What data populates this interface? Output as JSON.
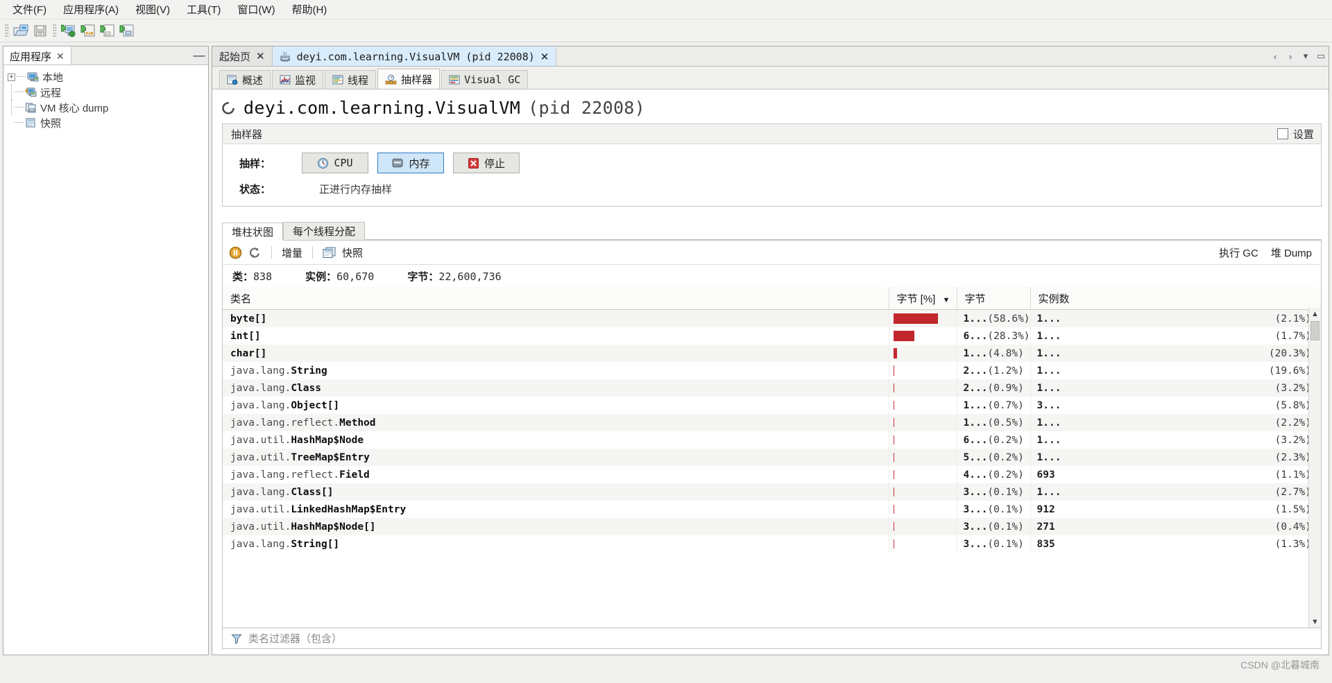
{
  "menubar": [
    {
      "label": "文件(F)",
      "mnemonic": "F"
    },
    {
      "label": "应用程序(A)",
      "mnemonic": "A"
    },
    {
      "label": "视图(V)",
      "mnemonic": "V"
    },
    {
      "label": "工具(T)",
      "mnemonic": "T"
    },
    {
      "label": "窗口(W)",
      "mnemonic": "W"
    },
    {
      "label": "帮助(H)",
      "mnemonic": "H"
    }
  ],
  "toolbar": {
    "buttons": [
      {
        "name": "open-file-icon"
      },
      {
        "name": "save-icon"
      },
      {
        "name": "add-remote-host-icon"
      },
      {
        "name": "add-jmx-connection-icon"
      },
      {
        "name": "load-snapshot-icon"
      },
      {
        "name": "add-vm-coredump-icon"
      }
    ]
  },
  "sidebar": {
    "tab_label": "应用程序",
    "close_label": "✕",
    "minimize_label": "—",
    "items": [
      {
        "label": "本地",
        "icon": "local-computer-icon",
        "expander": "+"
      },
      {
        "label": "远程",
        "icon": "remote-computer-icon",
        "expander": ""
      },
      {
        "label": "VM 核心 dump",
        "icon": "vm-coredump-icon",
        "expander": ""
      },
      {
        "label": "快照",
        "icon": "snapshot-icon",
        "expander": ""
      }
    ]
  },
  "document_tabs": [
    {
      "label": "起始页",
      "icon": "",
      "active": false,
      "closable": true
    },
    {
      "label": "deyi.com.learning.VisualVM (pid 22008)",
      "icon": "java-cup-icon",
      "active": true,
      "closable": true
    }
  ],
  "document_tab_controls": [
    "‹",
    "›",
    "▾",
    "▭"
  ],
  "sub_tabs": [
    {
      "label": "概述",
      "icon": "overview-icon",
      "active": false
    },
    {
      "label": "监视",
      "icon": "monitor-icon",
      "active": false
    },
    {
      "label": "线程",
      "icon": "threads-icon",
      "active": false
    },
    {
      "label": "抽样器",
      "icon": "sampler-icon",
      "active": true
    },
    {
      "label": "Visual GC",
      "icon": "visualgc-icon",
      "active": false
    }
  ],
  "app": {
    "title": "deyi.com.learning.VisualVM",
    "pid_text": "(pid 22008)",
    "icon": "loading-spinner-icon"
  },
  "sampler_panel": {
    "header": "抽样器",
    "settings_label": "设置",
    "settings_checked": false,
    "sample_label": "抽样：",
    "buttons": [
      {
        "label": "CPU",
        "icon": "clock-icon",
        "state": "normal"
      },
      {
        "label": "内存",
        "icon": "memory-chip-icon",
        "state": "selected"
      },
      {
        "label": "停止",
        "icon": "stop-red-x-icon",
        "state": "normal"
      }
    ],
    "status_label": "状态：",
    "status_value": "正进行内存抽样"
  },
  "result_tabs": [
    {
      "label": "堆柱状图",
      "active": true
    },
    {
      "label": "每个线程分配",
      "active": false
    }
  ],
  "result_toolbar": {
    "pause_icon": "pause-icon",
    "refresh_icon": "refresh-icon",
    "delta_label": "增量",
    "snapshot_label": "快照",
    "snapshot_icon": "snapshot-doc-icon",
    "gc_label": "执行 GC",
    "heapdump_label": "堆 Dump"
  },
  "counts": {
    "classes_label": "类：",
    "classes_value": "838",
    "instances_label": "实例：",
    "instances_value": "60,670",
    "bytes_label": "字节：",
    "bytes_value": "22,600,736"
  },
  "table": {
    "columns": [
      {
        "label": "类名",
        "key": "name"
      },
      {
        "label": "字节 [%]",
        "key": "bytes_bar",
        "sorted": "desc",
        "sort_glyph": "▼"
      },
      {
        "label": "字节",
        "key": "bytes"
      },
      {
        "label": "实例数",
        "key": "instances"
      }
    ],
    "rows": [
      {
        "pkg": "",
        "cls": "byte[]",
        "bar_pct": 58.6,
        "bytes": "1...",
        "bytes_pct": "(58.6%)",
        "instances": "1...",
        "inst_pct": "(2.1%)"
      },
      {
        "pkg": "",
        "cls": "int[]",
        "bar_pct": 28.3,
        "bytes": "6...",
        "bytes_pct": "(28.3%)",
        "instances": "1...",
        "inst_pct": "(1.7%)"
      },
      {
        "pkg": "",
        "cls": "char[]",
        "bar_pct": 4.8,
        "bytes": "1...",
        "bytes_pct": "(4.8%)",
        "instances": "1...",
        "inst_pct": "(20.3%)"
      },
      {
        "pkg": "java.lang.",
        "cls": "String",
        "bar_pct": 1.2,
        "bytes": "2...",
        "bytes_pct": "(1.2%)",
        "instances": "1...",
        "inst_pct": "(19.6%)"
      },
      {
        "pkg": "java.lang.",
        "cls": "Class",
        "bar_pct": 0.9,
        "bytes": "2...",
        "bytes_pct": "(0.9%)",
        "instances": "1...",
        "inst_pct": "(3.2%)"
      },
      {
        "pkg": "java.lang.",
        "cls": "Object[]",
        "bar_pct": 0.7,
        "bytes": "1...",
        "bytes_pct": "(0.7%)",
        "instances": "3...",
        "inst_pct": "(5.8%)"
      },
      {
        "pkg": "java.lang.reflect.",
        "cls": "Method",
        "bar_pct": 0.5,
        "bytes": "1...",
        "bytes_pct": "(0.5%)",
        "instances": "1...",
        "inst_pct": "(2.2%)"
      },
      {
        "pkg": "java.util.",
        "cls": "HashMap$Node",
        "bar_pct": 0.2,
        "bytes": "6...",
        "bytes_pct": "(0.2%)",
        "instances": "1...",
        "inst_pct": "(3.2%)"
      },
      {
        "pkg": "java.util.",
        "cls": "TreeMap$Entry",
        "bar_pct": 0.2,
        "bytes": "5...",
        "bytes_pct": "(0.2%)",
        "instances": "1...",
        "inst_pct": "(2.3%)"
      },
      {
        "pkg": "java.lang.reflect.",
        "cls": "Field",
        "bar_pct": 0.2,
        "bytes": "4...",
        "bytes_pct": "(0.2%)",
        "instances": "693",
        "inst_pct": "(1.1%)"
      },
      {
        "pkg": "java.lang.",
        "cls": "Class[]",
        "bar_pct": 0.1,
        "bytes": "3...",
        "bytes_pct": "(0.1%)",
        "instances": "1...",
        "inst_pct": "(2.7%)"
      },
      {
        "pkg": "java.util.",
        "cls": "LinkedHashMap$Entry",
        "bar_pct": 0.1,
        "bytes": "3...",
        "bytes_pct": "(0.1%)",
        "instances": "912",
        "inst_pct": "(1.5%)"
      },
      {
        "pkg": "java.util.",
        "cls": "HashMap$Node[]",
        "bar_pct": 0.1,
        "bytes": "3...",
        "bytes_pct": "(0.1%)",
        "instances": "271",
        "inst_pct": "(0.4%)"
      },
      {
        "pkg": "java.lang.",
        "cls": "String[]",
        "bar_pct": 0.1,
        "bytes": "3...",
        "bytes_pct": "(0.1%)",
        "instances": "835",
        "inst_pct": "(1.3%)"
      }
    ]
  },
  "filter": {
    "icon": "filter-funnel-icon",
    "placeholder": "类名过滤器（包含）"
  },
  "footer": {
    "watermark": "CSDN @北暮城南"
  },
  "colors": {
    "bar": "#c1272d",
    "selected_tab": "#d9ecfb",
    "selected_button": "#cfe6f8",
    "accent_border": "#2f7bbf"
  }
}
